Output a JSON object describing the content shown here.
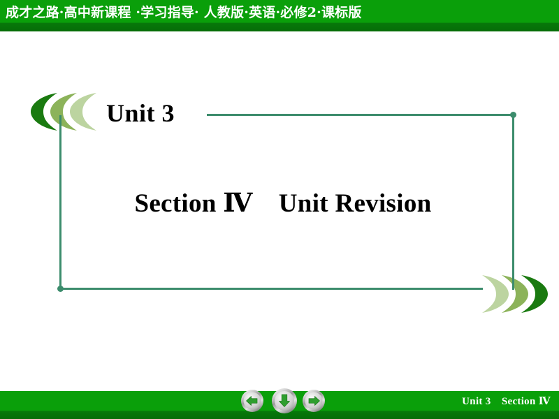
{
  "header": {
    "banner_text": "成才之路·高中新课程 ·学习指导· 人教版·英语·必修2·课标版",
    "bg_color": "#0a9f0a",
    "bg_color_dark": "#066c07",
    "text_color": "#ffffff"
  },
  "slide": {
    "unit_title": "Unit 3",
    "section_title": "Section Ⅳ Unit Revision",
    "frame_color": "#3c8c6c",
    "title_color": "#000000"
  },
  "decorations": {
    "left_chevrons": {
      "direction": "left",
      "colors": [
        "#1a7a10",
        "#8cb35a",
        "#bcd4a0"
      ]
    },
    "right_chevrons": {
      "direction": "right",
      "colors": [
        "#bcd4a0",
        "#8cb35a",
        "#1a7a10"
      ]
    }
  },
  "footer": {
    "unit_label": "Unit 3",
    "section_label": "Section Ⅳ",
    "combined_label": "Unit 3 Section Ⅳ",
    "bg_color": "#0a9f0a",
    "text_color": "#ffffff",
    "nav": {
      "previous": "previous-slide",
      "down": "next-animation",
      "next": "next-slide",
      "arrow_color": "#2f9e2f"
    }
  }
}
